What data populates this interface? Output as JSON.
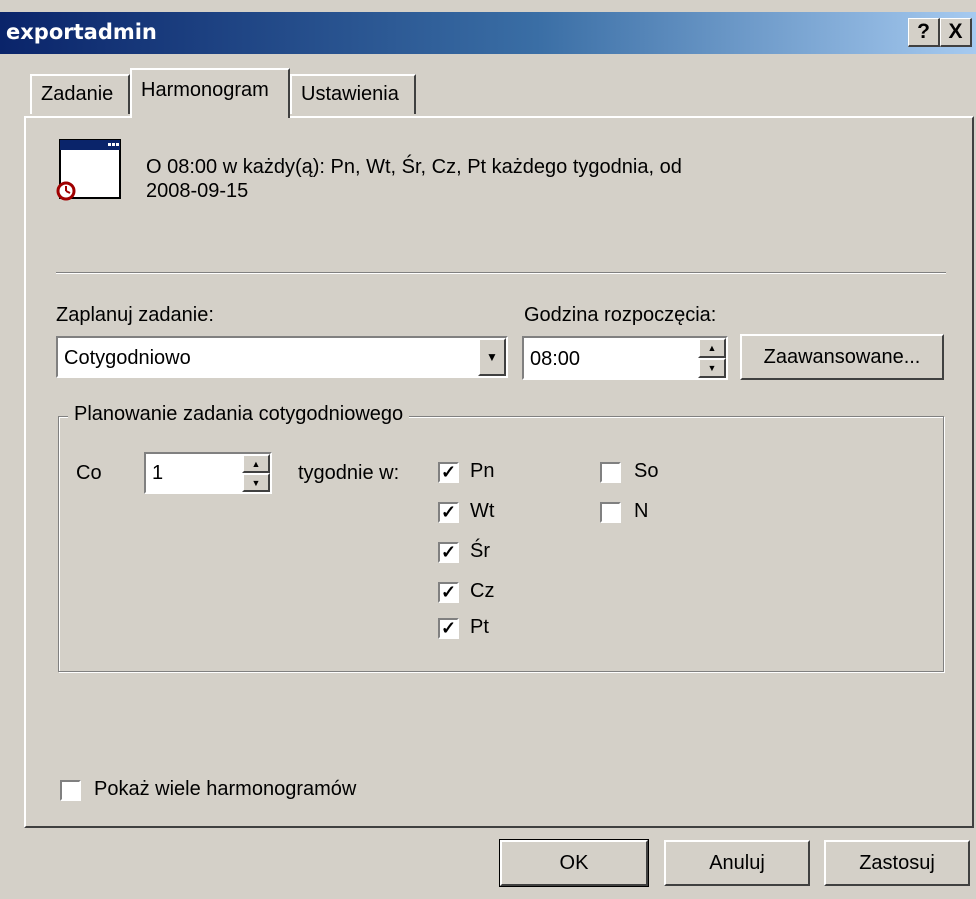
{
  "window": {
    "title": "exportadmin",
    "help_label": "?",
    "close_label": "X"
  },
  "tabs": [
    {
      "label": "Zadanie",
      "active": false
    },
    {
      "label": "Harmonogram",
      "active": true
    },
    {
      "label": "Ustawienia",
      "active": false
    }
  ],
  "summary": {
    "icon": "scheduled-window-icon",
    "line1": "O 08:00 w każdy(ą): Pn, Wt, Śr, Cz, Pt każdego tygodnia, od",
    "line2": "2008-09-15"
  },
  "schedule": {
    "label": "Zaplanuj zadanie:",
    "value": "Cotygodniowo"
  },
  "start_time": {
    "label": "Godzina rozpoczęcia:",
    "value": "08:00"
  },
  "advanced_button": "Zaawansowane...",
  "weekly": {
    "group_title": "Planowanie zadania cotygodniowego",
    "every_label": "Co",
    "every_value": "1",
    "weeks_on_label": "tygodnie w:",
    "days": [
      {
        "label": "Pn",
        "checked": true
      },
      {
        "label": "Wt",
        "checked": true
      },
      {
        "label": "Śr",
        "checked": true
      },
      {
        "label": "Cz",
        "checked": true
      },
      {
        "label": "Pt",
        "checked": true
      },
      {
        "label": "So",
        "checked": false
      },
      {
        "label": "N",
        "checked": false
      }
    ]
  },
  "multiple_schedules": {
    "label": "Pokaż wiele harmonogramów",
    "checked": false
  },
  "buttons": {
    "ok": "OK",
    "cancel": "Anuluj",
    "apply": "Zastosuj"
  },
  "colors": {
    "titlebar_start": "#0a246a",
    "titlebar_end": "#a6caf0",
    "face": "#d4d0c8"
  }
}
